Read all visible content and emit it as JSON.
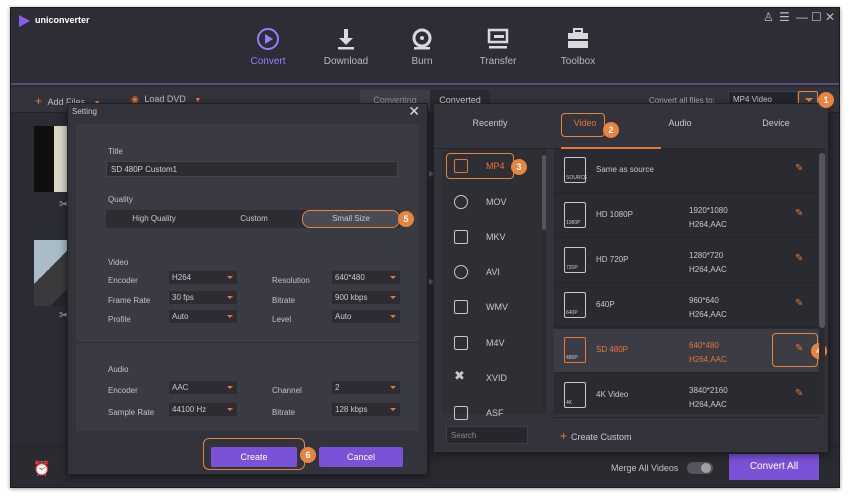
{
  "app": {
    "name": "uniconverter"
  },
  "window_controls": {
    "user": "♙",
    "menu": "☰",
    "minimize": "—",
    "maximize": "☐",
    "close": "✕"
  },
  "nav": [
    {
      "label": "Convert",
      "icon": "convert-icon",
      "active": true
    },
    {
      "label": "Download",
      "icon": "download-icon"
    },
    {
      "label": "Burn",
      "icon": "burn-icon"
    },
    {
      "label": "Transfer",
      "icon": "transfer-icon"
    },
    {
      "label": "Toolbox",
      "icon": "toolbox-icon"
    }
  ],
  "toolbar": {
    "add_files": "Add Files",
    "load_dvd": "Load DVD",
    "converting": "Converting",
    "converted": "Converted",
    "convert_all_label": "Convert all files to:",
    "convert_all_value": "MP4 Video"
  },
  "bottom": {
    "merge_label": "Merge All Videos",
    "merge_enabled": false,
    "convert_all": "Convert All"
  },
  "setting": {
    "window_title": "Setting",
    "title_label": "Title",
    "title_value": "SD 480P Custom1",
    "quality_label": "Quality",
    "quality_options": [
      "High Quality",
      "Custom",
      "Small Size"
    ],
    "quality_selected": "Small Size",
    "video_label": "Video",
    "video": {
      "encoder_label": "Encoder",
      "encoder": "H264",
      "resolution_label": "Resolution",
      "resolution": "640*480",
      "frame_rate_label": "Frame Rate",
      "frame_rate": "30 fps",
      "bitrate_label": "Bitrate",
      "bitrate": "900 kbps",
      "profile_label": "Profile",
      "profile": "Auto",
      "level_label": "Level",
      "level": "Auto"
    },
    "audio_label": "Audio",
    "audio": {
      "encoder_label": "Encoder",
      "encoder": "AAC",
      "channel_label": "Channel",
      "channel": "2",
      "sample_rate_label": "Sample Rate",
      "sample_rate": "44100 Hz",
      "bitrate_label": "Bitrate",
      "bitrate": "128 kbps"
    },
    "create": "Create",
    "cancel": "Cancel"
  },
  "format_panel": {
    "tabs": [
      "Recently",
      "Video",
      "Audio",
      "Device"
    ],
    "active_tab": "Video",
    "formats": [
      "MP4",
      "MOV",
      "MKV",
      "AVI",
      "WMV",
      "M4V",
      "XVID",
      "ASF"
    ],
    "selected_format": "MP4",
    "presets": [
      {
        "name": "Same as source",
        "tag": "SOURCE",
        "res": "",
        "codec": ""
      },
      {
        "name": "HD 1080P",
        "tag": "1080P",
        "res": "1920*1080",
        "codec": "H264,AAC"
      },
      {
        "name": "HD 720P",
        "tag": "720P",
        "res": "1280*720",
        "codec": "H264,AAC"
      },
      {
        "name": "640P",
        "tag": "640P",
        "res": "960*640",
        "codec": "H264,AAC"
      },
      {
        "name": "SD 480P",
        "tag": "480P",
        "res": "640*480",
        "codec": "H264,AAC"
      },
      {
        "name": "4K Video",
        "tag": "4K",
        "res": "3840*2160",
        "codec": "H264,AAC"
      }
    ],
    "selected_preset": "SD 480P",
    "search_placeholder": "Search",
    "create_custom": "Create Custom"
  },
  "step_badges": [
    "1",
    "2",
    "3",
    "4",
    "5",
    "6"
  ],
  "colors": {
    "accent_orange": "#e8843e",
    "accent_purple": "#7a52d8",
    "bg": "#2b2b33"
  }
}
